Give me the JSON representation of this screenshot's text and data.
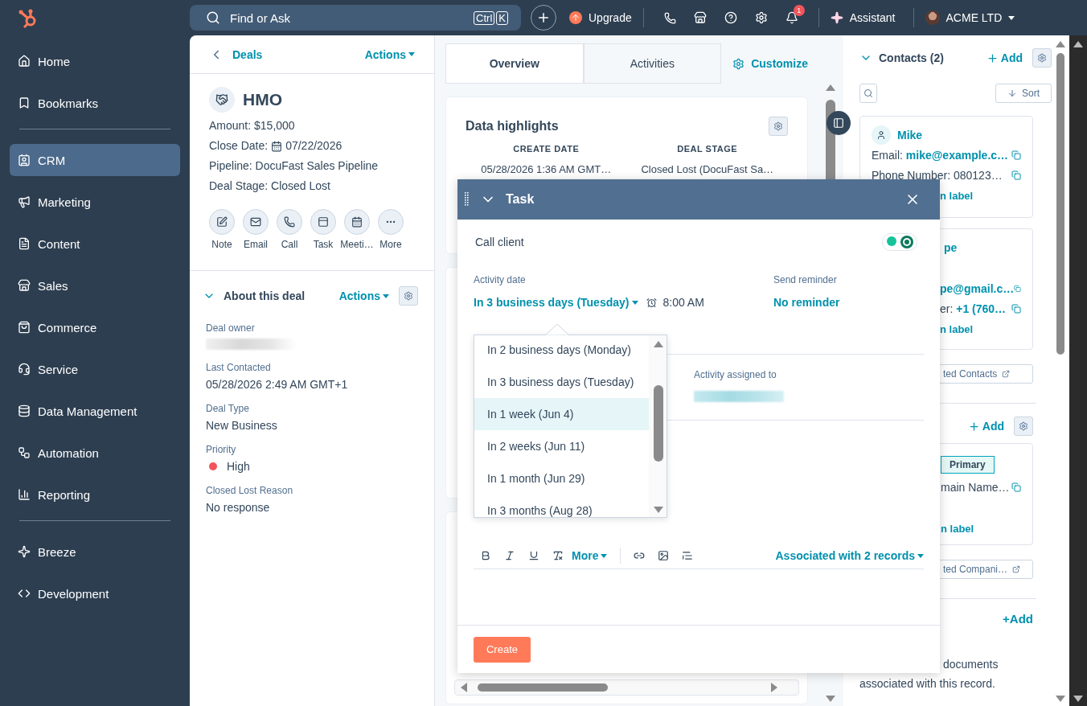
{
  "sidebar": {
    "groups": [
      {
        "items": [
          {
            "label": "Home",
            "selected": false
          },
          {
            "label": "Bookmarks",
            "selected": false
          }
        ]
      },
      {
        "items": [
          {
            "label": "CRM",
            "selected": true
          },
          {
            "label": "Marketing",
            "selected": false
          },
          {
            "label": "Content",
            "selected": false
          },
          {
            "label": "Sales",
            "selected": false
          },
          {
            "label": "Commerce",
            "selected": false
          },
          {
            "label": "Service",
            "selected": false
          },
          {
            "label": "Data Management",
            "selected": false
          },
          {
            "label": "Automation",
            "selected": false
          },
          {
            "label": "Reporting",
            "selected": false
          }
        ]
      },
      {
        "items": [
          {
            "label": "Breeze",
            "selected": false
          },
          {
            "label": "Development",
            "selected": false
          }
        ]
      }
    ]
  },
  "topbar": {
    "search": {
      "placeholder": "Find or Ask",
      "keys": [
        "Ctrl",
        "K"
      ]
    },
    "upgrade": "Upgrade",
    "notifications": "1",
    "assistant": "Assistant",
    "account": "ACME LTD"
  },
  "record": {
    "back": "Deals",
    "actions": "Actions",
    "title": "HMO",
    "fields": [
      {
        "kind": "text",
        "label": "Amount:",
        "value": "$15,000"
      },
      {
        "kind": "date",
        "label": "Close Date:",
        "value": "07/22/2026"
      },
      {
        "kind": "text",
        "label": "Pipeline:",
        "value": "DocuFast Sales Pipeline"
      },
      {
        "kind": "text",
        "label": "Deal Stage:",
        "value": "Closed Lost"
      }
    ],
    "activity_buttons": [
      "Note",
      "Email",
      "Call",
      "Task",
      "Meeti…",
      "More"
    ]
  },
  "about": {
    "title": "About this deal",
    "expanded": true,
    "actions": "Actions",
    "properties": [
      {
        "kind": "redacted",
        "label": "Deal owner"
      },
      {
        "kind": "text",
        "label": "Last Contacted",
        "value": "05/28/2026 2:49 AM GMT+1"
      },
      {
        "kind": "text",
        "label": "Deal Type",
        "value": "New Business"
      },
      {
        "kind": "status",
        "label": "Priority",
        "value": "High",
        "color": "#f2545b"
      },
      {
        "kind": "text",
        "label": "Closed Lost Reason",
        "value": "No response"
      }
    ]
  },
  "middle": {
    "tabs": [
      {
        "label": "Overview",
        "selected": true
      },
      {
        "label": "Activities",
        "selected": false
      }
    ],
    "customize": "Customize",
    "highlights": {
      "title": "Data highlights",
      "columns": [
        {
          "heading": "CREATE DATE",
          "value": "05/28/2026 1:36 AM GMT…"
        },
        {
          "heading": "DEAL STAGE",
          "value": "Closed Lost (DocuFast Sa…"
        }
      ]
    }
  },
  "task": {
    "title": "Task",
    "subject": "Call client",
    "activity_date": {
      "label": "Activity date",
      "value": "In 3 business days (Tuesday)",
      "time": "8:00 AM"
    },
    "reminder": {
      "label": "Send reminder",
      "value": "No reminder"
    },
    "assigned": {
      "label": "Activity assigned to"
    },
    "date_options": [
      {
        "label": "In 2 business days (Monday)",
        "selected": false
      },
      {
        "label": "In 3 business days (Tuesday)",
        "selected": false
      },
      {
        "label": "In 1 week (Jun 4)",
        "selected": true
      },
      {
        "label": "In 2 weeks (Jun 11)",
        "selected": false
      },
      {
        "label": "In 1 month (Jun 29)",
        "selected": false
      },
      {
        "label": "In 3 months (Aug 28)",
        "selected": false
      }
    ],
    "toolbar_more": "More",
    "associated": "Associated with 2 records",
    "create": "Create"
  },
  "right": {
    "contacts": {
      "title": "Contacts (2)",
      "add": "Add",
      "sort": "Sort",
      "cards": [
        {
          "name": "Mike",
          "email_label": "Email:",
          "email": "mike@example.c…",
          "phone_label": "Phone Number:",
          "phone": "080123…",
          "label_link": "n label"
        },
        {
          "name": "pe",
          "email": "pe@gmail.c…",
          "phone_label": "er:",
          "phone": "+1 (760…",
          "label_link": "n label"
        }
      ],
      "view_all": "ted Contacts"
    },
    "companies": {
      "add": "Add",
      "tag": "Primary",
      "domain": "main Name…",
      "label_link": "n label",
      "view_all": "ted Compani…"
    },
    "attachments": {
      "add": "+Add",
      "text_1": "documents",
      "text_2": "associated with this record."
    }
  }
}
